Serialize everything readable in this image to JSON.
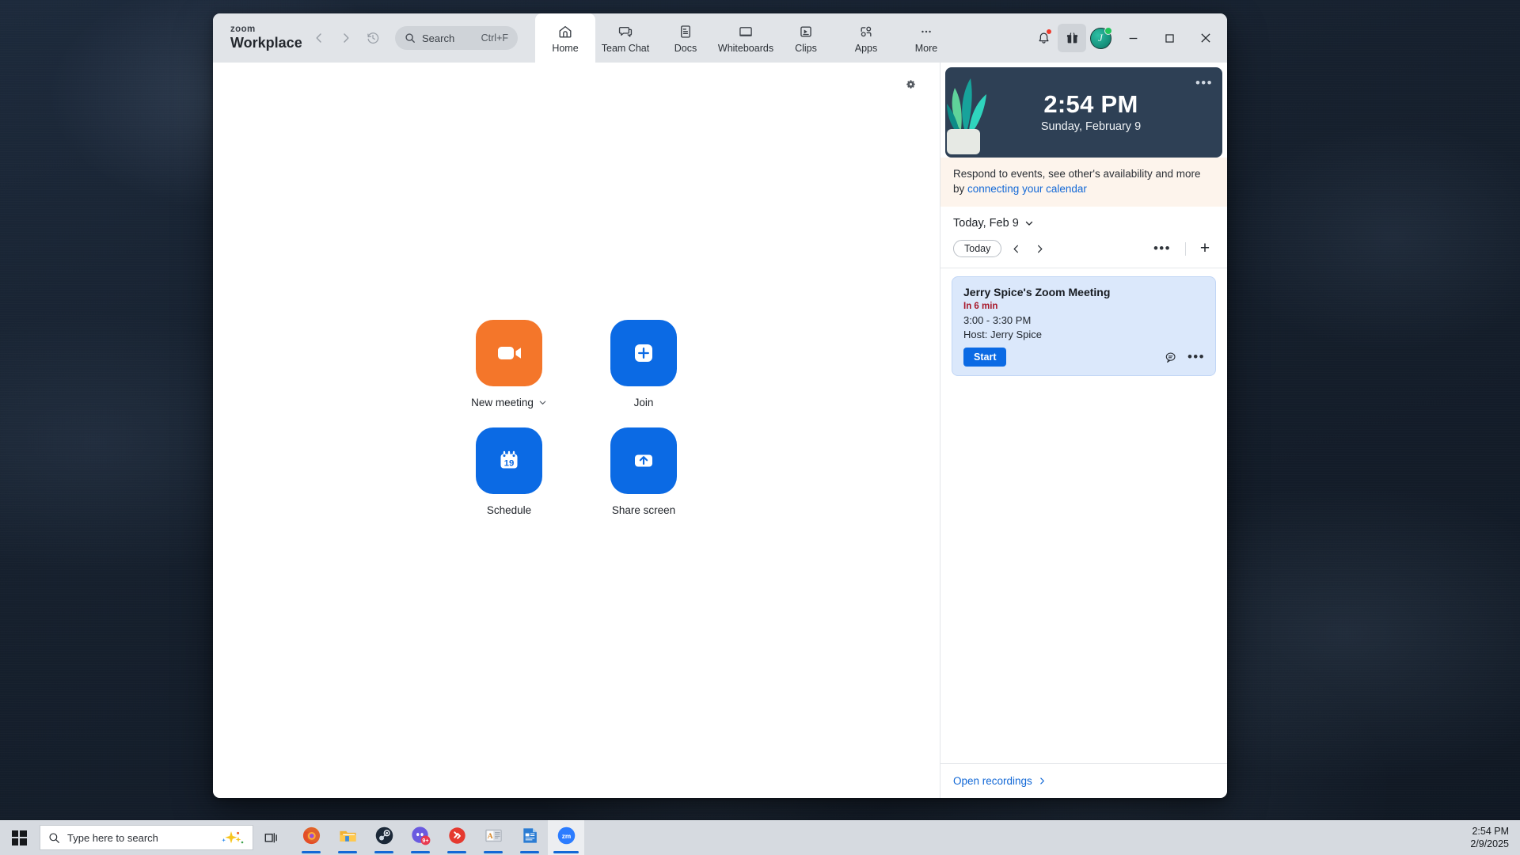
{
  "window": {
    "brand_top": "zoom",
    "brand_bottom": "Workplace",
    "search": {
      "placeholder": "Search",
      "shortcut": "Ctrl+F",
      "icon": "search-icon"
    },
    "nav": {
      "back": "chevron-left-icon",
      "forward": "chevron-right-icon",
      "history": "history-clock-icon"
    },
    "tabs": [
      {
        "label": "Home",
        "icon": "home-icon",
        "active": true
      },
      {
        "label": "Team Chat",
        "icon": "chat-bubble-icon",
        "active": false
      },
      {
        "label": "Docs",
        "icon": "document-icon",
        "active": false
      },
      {
        "label": "Whiteboards",
        "icon": "whiteboard-icon",
        "active": false
      },
      {
        "label": "Clips",
        "icon": "clips-play-icon",
        "active": false
      },
      {
        "label": "Apps",
        "icon": "apps-icon",
        "active": false
      },
      {
        "label": "More",
        "icon": "more-dots-icon",
        "active": false
      }
    ],
    "title_actions": [
      {
        "name": "notifications-bell",
        "icon": "bell-icon",
        "badge": true
      },
      {
        "name": "gift-box",
        "icon": "gift-icon",
        "badge": false
      },
      {
        "name": "user-avatar",
        "icon": "avatar-icon",
        "initials": "J",
        "presence": "available"
      }
    ],
    "controls": {
      "minimize": "minimize-icon",
      "maximize": "maximize-icon",
      "close": "close-icon"
    }
  },
  "main": {
    "settings_icon": "gear-icon",
    "actions": [
      {
        "label": "New meeting",
        "icon": "video-camera-icon",
        "color": "#f4762a",
        "has_dropdown": true
      },
      {
        "label": "Join",
        "icon": "plus-square-icon",
        "color": "#0b6ae4",
        "has_dropdown": false
      },
      {
        "label": "Schedule",
        "icon": "calendar-19-icon",
        "color": "#0b6ae4",
        "has_dropdown": false,
        "calendar_day": "19"
      },
      {
        "label": "Share screen",
        "icon": "up-arrow-screen-icon",
        "color": "#0b6ae4",
        "has_dropdown": false
      }
    ]
  },
  "right_panel": {
    "clock": {
      "time": "2:54 PM",
      "date": "Sunday, February 9",
      "menu_icon": "more-dots-icon",
      "background_color": "#2e4055",
      "illustration": "plant-icon"
    },
    "calendar_banner": {
      "text_before": "Respond to events, see other's availability and more by ",
      "link_text": "connecting your calendar",
      "background_color": "#fdf4ec",
      "link_color": "#1268d6"
    },
    "day_selector": {
      "label": "Today, Feb 9",
      "icon": "chevron-down-icon"
    },
    "nav_row": {
      "today_label": "Today",
      "prev_icon": "chevron-left-icon",
      "next_icon": "chevron-right-icon",
      "more_icon": "more-dots-icon",
      "add_icon": "plus-icon"
    },
    "events": [
      {
        "title": "Jerry Spice's Zoom Meeting",
        "starts_in": "In 6 min",
        "time_range": "3:00 - 3:30 PM",
        "host": "Host: Jerry Spice",
        "primary_button": "Start",
        "chat_icon": "meeting-chat-icon",
        "more_icon": "more-dots-icon",
        "accent_color": "#0b6ae4"
      }
    ],
    "footer": {
      "link": "Open recordings",
      "icon": "chevron-right-icon"
    }
  },
  "taskbar": {
    "start_icon": "windows-logo-icon",
    "search_placeholder": "Type here to search",
    "search_icon": "search-icon",
    "copilot_icon": "sparkle-icon",
    "task_view_icon": "task-view-icon",
    "apps": [
      {
        "name": "firefox",
        "icon": "firefox-icon",
        "active": false,
        "badge": ""
      },
      {
        "name": "file-explorer",
        "icon": "folder-icon",
        "active": false,
        "badge": ""
      },
      {
        "name": "steam",
        "icon": "steam-icon",
        "active": false,
        "badge": ""
      },
      {
        "name": "discord",
        "icon": "discord-icon",
        "active": false,
        "badge": "9+"
      },
      {
        "name": "remote-desktop",
        "icon": "remote-desktop-icon",
        "active": false,
        "badge": ""
      },
      {
        "name": "dictionary-app",
        "icon": "letter-a-icon",
        "active": false,
        "badge": ""
      },
      {
        "name": "word-document",
        "icon": "document-blue-icon",
        "active": false,
        "badge": ""
      },
      {
        "name": "zoom",
        "icon": "zoom-icon",
        "active": true,
        "badge": ""
      }
    ],
    "clock": {
      "time": "2:54 PM",
      "date": "2/9/2025"
    }
  }
}
